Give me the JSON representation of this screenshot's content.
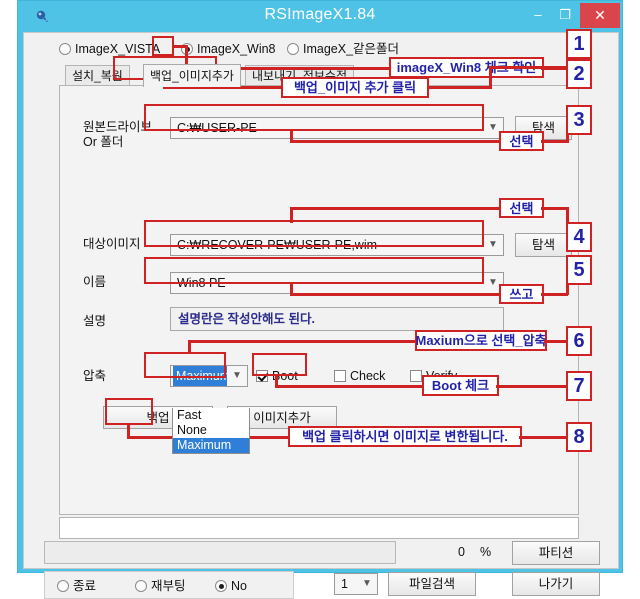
{
  "window": {
    "title": "RSImageX1.84",
    "icon": "app-icon",
    "minimize": "–",
    "maximize": "❐",
    "close": "✕"
  },
  "modes": [
    {
      "label": "ImageX_VISTA",
      "selected": false
    },
    {
      "label": "ImageX_Win8",
      "selected": true
    },
    {
      "label": "ImageX_같은폴더",
      "selected": false
    }
  ],
  "tabs": [
    {
      "label": "설치_복원",
      "active": false
    },
    {
      "label": "백업_이미지추가",
      "active": true
    },
    {
      "label": "내보내기_정보수정",
      "active": false
    }
  ],
  "form": {
    "source_label_line1": "원본드라이브",
    "source_label_line2": "Or 폴더",
    "source_value": "C:₩USER-PE",
    "source_browse": "탐색",
    "target_label": "대상이미지",
    "target_value": "C:₩RECOVER-PE₩USER-PE,wim",
    "target_browse": "탐색",
    "name_label": "이름",
    "name_value": "Win8 PE",
    "desc_label": "설명",
    "desc_value": "설명란은 작성안해도 된다.",
    "compress_label": "압축",
    "compress_value": "Maximum",
    "compress_options": [
      "Fast",
      "None",
      "Maximum"
    ],
    "compress_selected_option": "Maximum",
    "checkboxes": [
      {
        "label": "Boot",
        "checked": true
      },
      {
        "label": "Check",
        "checked": false
      },
      {
        "label": "Verify",
        "checked": false
      }
    ],
    "backup_button": "백업",
    "addimage_button": "이미지추가"
  },
  "status": {
    "progress_percent": "0",
    "percent_sign": "%",
    "partition_button": "파티션"
  },
  "bottom": {
    "options": [
      {
        "label": "종료",
        "selected": false
      },
      {
        "label": "재부팅",
        "selected": false
      },
      {
        "label": "No",
        "selected": true
      }
    ],
    "count_value": "1",
    "filesearch_button": "파일검색",
    "exit_button": "나가기"
  },
  "annotations": {
    "numbers": [
      "1",
      "2",
      "3",
      "4",
      "5",
      "6",
      "7",
      "8"
    ],
    "callouts": [
      "imageX_Win8 체크 확인",
      "백업_이미지 추가 클릭",
      "선택",
      "선택",
      "쓰고",
      "Maxium으로 선택_압축",
      "Boot 체크",
      "백업 클릭하시면 이미지로 변한됩니다.",
      "백업"
    ]
  },
  "colors": {
    "titlebar": "#4ec3e6",
    "close_button": "#d9454a",
    "annotation_red": "#cf2222",
    "annotation_blue": "#2323a8",
    "list_selection": "#2f7fd8"
  }
}
